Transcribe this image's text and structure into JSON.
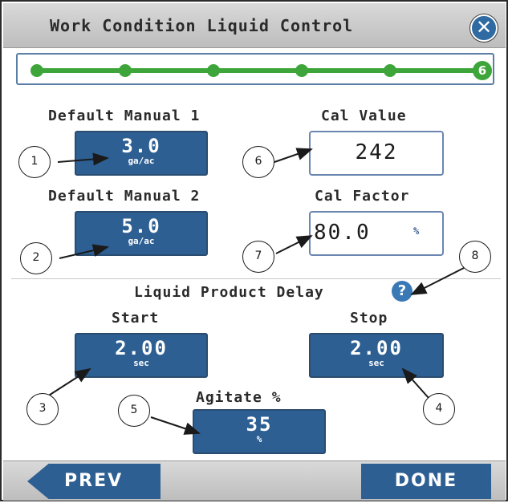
{
  "window": {
    "title": "Work Condition Liquid Control",
    "close_icon": "close-icon"
  },
  "progress": {
    "current_step": "6",
    "total_steps": 6
  },
  "fields": {
    "default_manual_1": {
      "label": "Default Manual 1",
      "value": "3.0",
      "unit": "ga/ac"
    },
    "default_manual_2": {
      "label": "Default Manual 2",
      "value": "5.0",
      "unit": "ga/ac"
    },
    "cal_value": {
      "label": "Cal Value",
      "value": "242"
    },
    "cal_factor": {
      "label": "Cal Factor",
      "value": "80.0",
      "unit": "%"
    },
    "liquid_product_delay": {
      "label": "Liquid Product Delay"
    },
    "start": {
      "label": "Start",
      "value": "2.00",
      "unit": "sec"
    },
    "stop": {
      "label": "Stop",
      "value": "2.00",
      "unit": "sec"
    },
    "agitate": {
      "label": "Agitate %",
      "value": "35",
      "unit": "%"
    }
  },
  "help_icon": "question-icon",
  "callouts": [
    "1",
    "2",
    "3",
    "4",
    "5",
    "6",
    "7",
    "8"
  ],
  "footer": {
    "prev_label": "PREV",
    "done_label": "DONE"
  },
  "colors": {
    "accent_blue": "#2d5f93",
    "progress_green": "#3ea53a",
    "titlebar_gray": "#c8c8c8"
  }
}
